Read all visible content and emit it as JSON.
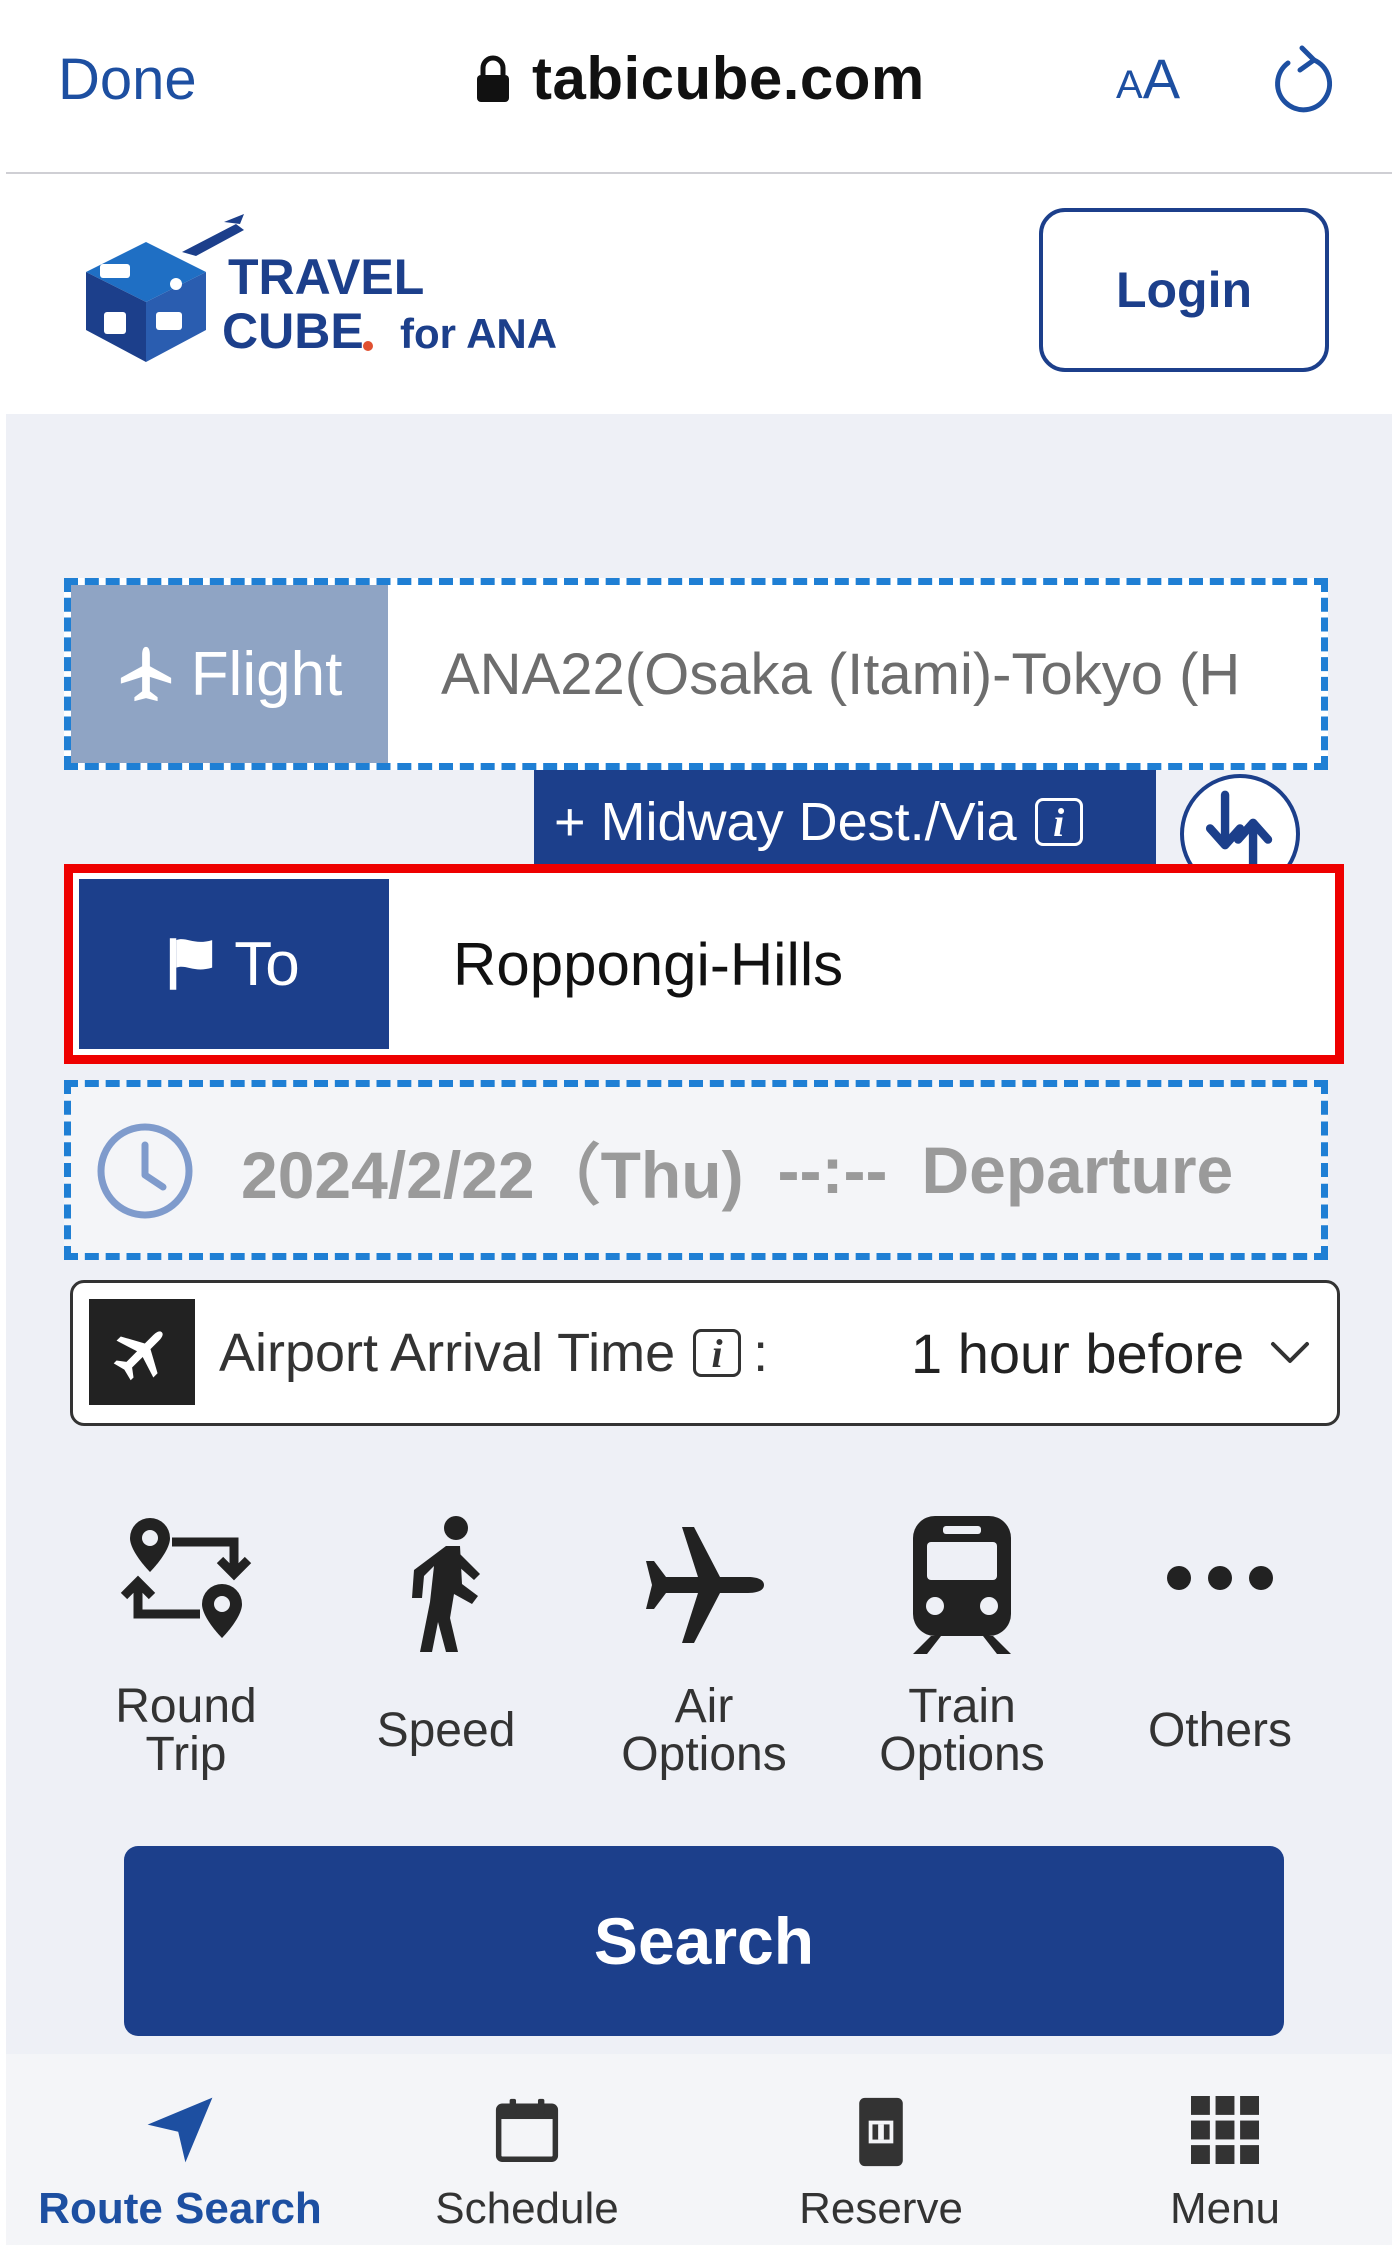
{
  "browser": {
    "done_label": "Done",
    "url": "tabicube.com",
    "text_size_label_small": "A",
    "text_size_label_large": "A"
  },
  "header": {
    "logo_line1": "TRAVEL",
    "logo_line2": "CUBE",
    "logo_suffix": "for ANA",
    "login_label": "Login"
  },
  "form": {
    "flight_label": "Flight",
    "flight_value": "ANA22(Osaka (Itami)-Tokyo (H",
    "midway_label": "+ Midway Dest./Via",
    "info_glyph": "i",
    "to_label": "To",
    "to_value": "Roppongi-Hills",
    "date_value": "2024/2/22（Thu)",
    "time_value": "--:--",
    "departure_label": "Departure",
    "airport_label": "Airport Arrival Time",
    "airport_colon": ":",
    "airport_value": "1 hour before"
  },
  "options": [
    {
      "line1": "Round",
      "line2": "Trip",
      "icon": "round-trip-icon"
    },
    {
      "line1": "Speed",
      "line2": "",
      "icon": "walking-icon"
    },
    {
      "line1": "Air",
      "line2": "Options",
      "icon": "airplane-icon"
    },
    {
      "line1": "Train",
      "line2": "Options",
      "icon": "train-icon"
    },
    {
      "line1": "Others",
      "line2": "",
      "icon": "more-icon"
    }
  ],
  "search_label": "Search",
  "bottom_nav": [
    {
      "label": "Route Search",
      "icon": "navigation-arrow-icon",
      "active": true
    },
    {
      "label": "Schedule",
      "icon": "calendar-icon",
      "active": false
    },
    {
      "label": "Reserve",
      "icon": "ticket-icon",
      "active": false
    },
    {
      "label": "Menu",
      "icon": "grid-icon",
      "active": false
    }
  ],
  "colors": {
    "brand_navy": "#1c3f8b",
    "link_blue": "#1d4fa1",
    "highlight_red": "#ee0000",
    "dashed_blue": "#1f7fd4",
    "panel_bg": "#eef0f6"
  }
}
